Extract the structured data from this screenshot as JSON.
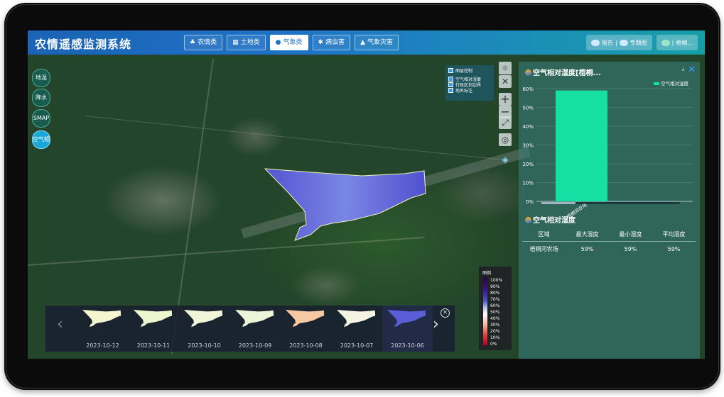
{
  "header": {
    "title": "农情遥感监测系统",
    "tabs": [
      {
        "label": "农情类",
        "icon": "crop-icon",
        "active": false
      },
      {
        "label": "土地类",
        "icon": "land-icon",
        "active": false
      },
      {
        "label": "气象类",
        "icon": "drop-icon",
        "active": true
      },
      {
        "label": "病虫害",
        "icon": "bug-icon",
        "active": false
      },
      {
        "label": "气象灾害",
        "icon": "warning-icon",
        "active": false
      }
    ],
    "report_label": "报告",
    "topic_map_label": "专题图",
    "user_label": "梧桐..."
  },
  "layer_buttons": [
    {
      "label": "地温",
      "active": false
    },
    {
      "label": "降水",
      "active": false
    },
    {
      "label": "SMAP",
      "active": false
    },
    {
      "label": "空气相",
      "active": true
    }
  ],
  "layer_control": {
    "title": "图层控制",
    "items": [
      "空气相对湿度",
      "行政区划边界",
      "地名标注"
    ]
  },
  "panel": {
    "title": "空气相对湿度[梧桐...",
    "table_title": "空气相对湿度",
    "table": {
      "headers": [
        "区域",
        "最大湿度",
        "最小湿度",
        "平均湿度"
      ],
      "rows": [
        [
          "梧桐河农场",
          "59%",
          "59%",
          "59%"
        ]
      ]
    }
  },
  "chart_data": {
    "type": "bar",
    "categories": [
      "梧桐河农场"
    ],
    "series": [
      {
        "name": "空气相对湿度",
        "values": [
          59
        ]
      }
    ],
    "ylim": [
      0,
      60
    ],
    "yticks": [
      "0%",
      "10%",
      "20%",
      "30%",
      "40%",
      "50%",
      "60%"
    ],
    "legend_position": "top-right",
    "color": "#16dfa4",
    "grid": true
  },
  "legend": {
    "title": "图例",
    "labels": [
      "100%",
      "90%",
      "80%",
      "70%",
      "60%",
      "50%",
      "40%",
      "30%",
      "20%",
      "10%",
      "0%"
    ]
  },
  "timeline": {
    "dates": [
      "2023-10-12",
      "2023-10-11",
      "2023-10-10",
      "2023-10-09",
      "2023-10-08",
      "2023-10-07",
      "2023-10-06"
    ],
    "thumb_colors": [
      "#f3f6cf",
      "#eef6cf",
      "#f2f6d8",
      "#eef4d8",
      "#f6c9a2",
      "#f3f4e2",
      "#5a5ed6"
    ],
    "active_index": 6
  },
  "colors": {
    "region_fill": "#5b5fd8",
    "header_start": "#1b63b5",
    "header_end": "#169ea7",
    "bar": "#16dfa4"
  }
}
